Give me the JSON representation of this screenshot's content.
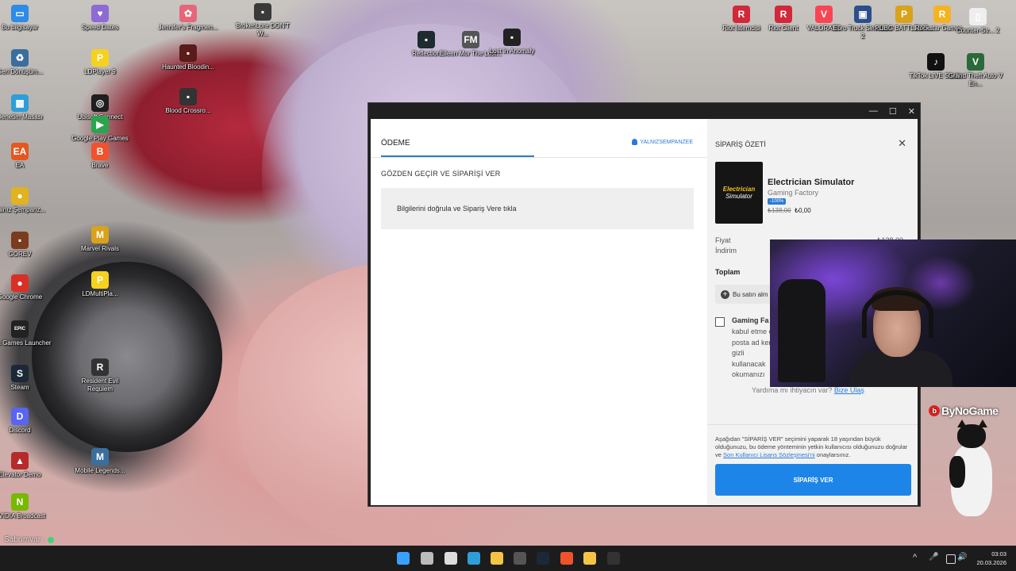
{
  "desktop": {
    "icons_left": [
      {
        "label": "Bu bilgisayar",
        "glyph": "▭",
        "color": "#2e8be6"
      },
      {
        "label": "Geri Dönüşüm...",
        "glyph": "♻",
        "color": "#3a6e9e"
      },
      {
        "label": "Denetim Masası",
        "glyph": "▦",
        "color": "#2d9ed8"
      },
      {
        "label": "EA",
        "glyph": "EA",
        "color": "#e5571f"
      },
      {
        "label": "Yalnız Şempanz...",
        "glyph": "●",
        "color": "#e0b31f"
      },
      {
        "label": "GÖREV",
        "glyph": "▪",
        "color": "#7a3c1d"
      },
      {
        "label": "Google Chrome",
        "glyph": "●",
        "color": "#d93025"
      },
      {
        "label": "Epic Games Launcher",
        "glyph": "EPIC",
        "color": "#222222"
      },
      {
        "label": "Steam",
        "glyph": "S",
        "color": "#1b2838"
      },
      {
        "label": "Discord",
        "glyph": "D",
        "color": "#5865f2"
      },
      {
        "label": "Elevator Demo",
        "glyph": "▲",
        "color": "#b52b2b"
      },
      {
        "label": "NVIDIA Broadcast",
        "glyph": "N",
        "color": "#76b900"
      }
    ],
    "icons_col2": [
      {
        "label": "Speed Dates",
        "glyph": "♥",
        "color": "#8e6ad6"
      },
      {
        "label": "LDPlayer 9",
        "glyph": "P",
        "color": "#f6d21f"
      },
      {
        "label": "Ubisoft Connect",
        "glyph": "◎",
        "color": "#1e1e1e"
      },
      {
        "label": "Google Play Games",
        "glyph": "▶",
        "color": "#2aa44f"
      },
      {
        "label": "Brave",
        "glyph": "B",
        "color": "#f0532b"
      },
      {
        "label": "Marvel Rivals",
        "glyph": "M",
        "color": "#d8a21b"
      },
      {
        "label": "LDMultiPla...",
        "glyph": "P",
        "color": "#f6d21f"
      },
      {
        "label": "Resident Evil Requiem",
        "glyph": "R",
        "color": "#333333"
      },
      {
        "label": "Mobile Legends...",
        "glyph": "M",
        "color": "#3a6e9e"
      }
    ],
    "icons_col3": [
      {
        "label": "Jennifer's Fragmen...",
        "glyph": "✿",
        "color": "#e5677a"
      },
      {
        "label": "Haunted Bloodin...",
        "glyph": "▪",
        "color": "#5a1b1b"
      },
      {
        "label": "Blood Crossro...",
        "glyph": "▪",
        "color": "#333333"
      }
    ],
    "icons_col4": [
      {
        "label": "BrokenLore DON'T W...",
        "glyph": "▪",
        "color": "#3a3a3a"
      }
    ],
    "icons_mid": [
      {
        "label": "Reflection",
        "glyph": "▪",
        "color": "#1f2a2e"
      },
      {
        "label": "Eileen Mor The Lost...",
        "glyph": "FM",
        "color": "#555555"
      },
      {
        "label": "Lost in Anomaly",
        "glyph": "▪",
        "color": "#222222"
      }
    ],
    "icons_right": [
      {
        "label": "Riot İstemcisi",
        "glyph": "R",
        "color": "#d1283a"
      },
      {
        "label": "Riot Client",
        "glyph": "R",
        "color": "#d1283a"
      },
      {
        "label": "VALORANT",
        "glyph": "V",
        "color": "#fa4454"
      },
      {
        "label": "Euro Truck Simulator 2",
        "glyph": "▣",
        "color": "#2c4e8a"
      },
      {
        "label": "PUBG BATTLEGR...",
        "glyph": "P",
        "color": "#d8a21b"
      },
      {
        "label": "Rockstar Games ...",
        "glyph": "R",
        "color": "#f6b321"
      },
      {
        "label": "Counter-Str... 2",
        "glyph": "▯",
        "color": "#eeeeee"
      },
      {
        "label": "TikTok LIVE Studio",
        "glyph": "♪",
        "color": "#111111"
      },
      {
        "label": "Grand Theft Auto V En...",
        "glyph": "V",
        "color": "#2a6a3a"
      }
    ]
  },
  "window": {
    "controls": {
      "minimize": "—",
      "maximize": "☐",
      "close": "✕"
    },
    "checkout": {
      "tab": "ÖDEME",
      "user": "YALNIZSEMPANZEE",
      "review_title": "GÖZDEN GEÇİR VE SİPARİŞİ VER",
      "info_text": "Bilgilerini doğrula ve Sipariş Vere tıkla"
    },
    "summary": {
      "title": "SİPARİŞ ÖZETİ",
      "close": "✕",
      "cover_line1": "Electrician",
      "cover_line2": "Simulator",
      "game_name": "Electrician Simulator",
      "developer": "Gaming Factory",
      "discount_badge": "-100%",
      "old_price": "₺138,00",
      "new_price": "₺0,00",
      "price_label": "Fiyat",
      "price_value": "₺138,00",
      "discount_label": "İndirim",
      "total_label": "Toplam",
      "add_text": "Bu satın alm",
      "consent_title": "Gaming Fa",
      "consent_text": "kabul etme e-posta ad kendi gizli kullanacak okumanızı",
      "consent_link": "gizli",
      "help_text": "Yardıma mı ihtiyacın var?",
      "help_link": "Bize Ulaş",
      "legal_text": "Aşağıdan \"SİPARİŞ VER\" seçimini yaparak 18 yaşından büyük olduğunuzu, bu ödeme yönteminin yetkin kullanıcısı olduğunuzu doğrular ve",
      "legal_link": "Son Kullanıcı Lisans Sözleşmesi'ni",
      "legal_suffix": "onaylarsınız.",
      "order_button": "SİPARİŞ VER"
    }
  },
  "overlay": {
    "brand": "ByNoGame",
    "status_text": "Sabrımvar :"
  },
  "taskbar": {
    "apps": [
      {
        "name": "windows-start",
        "color": "#3aa0ff"
      },
      {
        "name": "task-view",
        "color": "#bbbbbb"
      },
      {
        "name": "app-1",
        "color": "#dddddd"
      },
      {
        "name": "app-2",
        "color": "#2d9ed8"
      },
      {
        "name": "file-explorer",
        "color": "#f6c445"
      },
      {
        "name": "obs",
        "color": "#555555"
      },
      {
        "name": "steam",
        "color": "#1b2838"
      },
      {
        "name": "brave",
        "color": "#f0532b"
      },
      {
        "name": "media",
        "color": "#f6c445"
      },
      {
        "name": "epic",
        "color": "#333333"
      }
    ],
    "tray": {
      "chevron": "^",
      "mic": "🎤",
      "volume": "🔊"
    },
    "time": "03:03",
    "date": "20.03.2026"
  }
}
